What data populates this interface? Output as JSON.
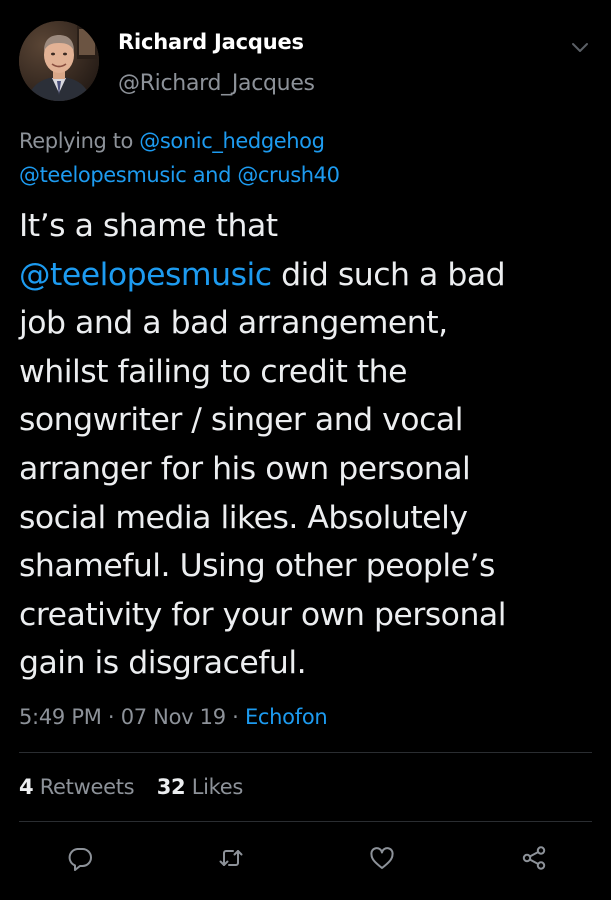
{
  "tweet": {
    "author": {
      "display_name": "Richard Jacques",
      "handle": "@Richard_Jacques"
    },
    "replying_to": {
      "prefix": "Replying to",
      "mention_1": "@sonic_hedgehog",
      "mention_2": "@teelopesmusic",
      "conjunction": "and",
      "mention_3": "@crush40"
    },
    "body": {
      "line_1": "It’s a shame that",
      "line_2_mention": "@teelopesmusic",
      "line_2_rest": " did such a bad",
      "line_3": "job and a bad arrangement,",
      "line_4": "whilst failing to credit the",
      "line_5": "songwriter / singer and vocal",
      "line_6": "arranger for his own personal",
      "line_7": "social media likes. Absolutely",
      "line_8": "shameful. Using other people’s",
      "line_9": "creativity for your own personal",
      "line_10": "gain is disgraceful."
    },
    "time": "5:49 PM",
    "date": "07 Nov 19",
    "separator": "·",
    "source": "Echofon",
    "retweets_count": "4",
    "retweets_label": "Retweets",
    "likes_count": "32",
    "likes_label": "Likes"
  },
  "actions": {
    "reply_icon": "reply-icon",
    "retweet_icon": "retweet-icon",
    "like_icon": "heart-icon",
    "share_icon": "share-icon"
  },
  "colors": {
    "background": "#000000",
    "text": "#eceef0",
    "secondary": "#8d9299",
    "link": "#1d9bf0",
    "divider": "#2a2d31"
  }
}
